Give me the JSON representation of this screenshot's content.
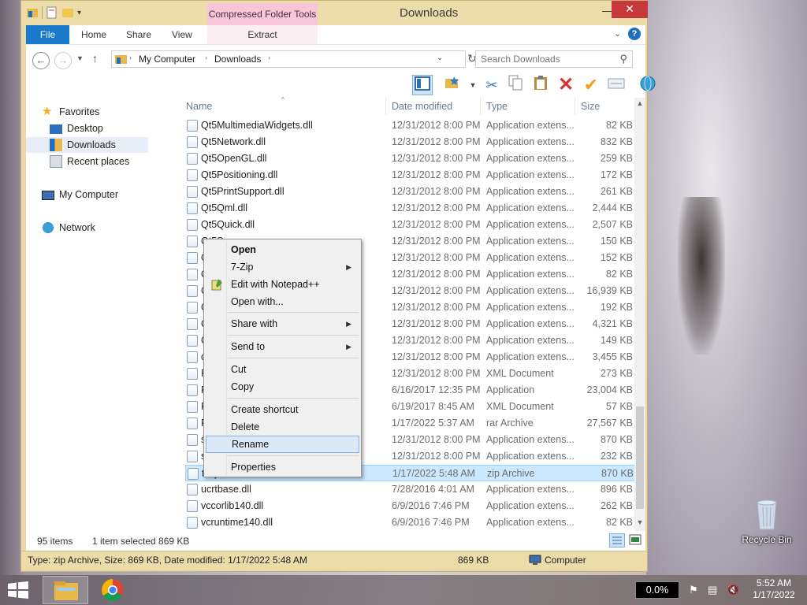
{
  "window": {
    "title": "Downloads",
    "context_tools_label": "Compressed Folder Tools",
    "minimize": "—",
    "maximize": "☐",
    "close": "✕"
  },
  "ribbon": {
    "tabs": [
      "File",
      "Home",
      "Share",
      "View",
      "Extract"
    ],
    "help": "?"
  },
  "address": {
    "breadcrumb": [
      "My Computer",
      "Downloads"
    ],
    "search_placeholder": "Search Downloads"
  },
  "nav": {
    "favorites": "Favorites",
    "desktop": "Desktop",
    "downloads": "Downloads",
    "recent": "Recent places",
    "computer": "My Computer",
    "network": "Network"
  },
  "columns": [
    "Name",
    "Date modified",
    "Type",
    "Size"
  ],
  "files": [
    {
      "name": "Qt5MultimediaWidgets.dll",
      "date": "12/31/2012 8:00 PM",
      "type": "Application extens...",
      "size": "82 KB"
    },
    {
      "name": "Qt5Network.dll",
      "date": "12/31/2012 8:00 PM",
      "type": "Application extens...",
      "size": "832 KB"
    },
    {
      "name": "Qt5OpenGL.dll",
      "date": "12/31/2012 8:00 PM",
      "type": "Application extens...",
      "size": "259 KB"
    },
    {
      "name": "Qt5Positioning.dll",
      "date": "12/31/2012 8:00 PM",
      "type": "Application extens...",
      "size": "172 KB"
    },
    {
      "name": "Qt5PrintSupport.dll",
      "date": "12/31/2012 8:00 PM",
      "type": "Application extens...",
      "size": "261 KB"
    },
    {
      "name": "Qt5Qml.dll",
      "date": "12/31/2012 8:00 PM",
      "type": "Application extens...",
      "size": "2,444 KB"
    },
    {
      "name": "Qt5Quick.dll",
      "date": "12/31/2012 8:00 PM",
      "type": "Application extens...",
      "size": "2,507 KB"
    },
    {
      "name": "Qt5Se",
      "date": "12/31/2012 8:00 PM",
      "type": "Application extens...",
      "size": "150 KB"
    },
    {
      "name": "Qt5Sc",
      "date": "12/31/2012 8:00 PM",
      "type": "Application extens...",
      "size": "152 KB"
    },
    {
      "name": "Qt5W",
      "date": "12/31/2012 8:00 PM",
      "type": "Application extens...",
      "size": "82 KB"
    },
    {
      "name": "Qt5W",
      "date": "12/31/2012 8:00 PM",
      "type": "Application extens...",
      "size": "16,939 KB"
    },
    {
      "name": "Qt5W",
      "date": "12/31/2012 8:00 PM",
      "type": "Application extens...",
      "size": "192 KB"
    },
    {
      "name": "Qt5W",
      "date": "12/31/2012 8:00 PM",
      "type": "Application extens...",
      "size": "4,321 KB"
    },
    {
      "name": "Qt5Xi",
      "date": "12/31/2012 8:00 PM",
      "type": "Application extens...",
      "size": "149 KB"
    },
    {
      "name": "qtnril",
      "date": "12/31/2012 8:00 PM",
      "type": "Application extens...",
      "size": "3,455 KB"
    },
    {
      "name": "Reflec",
      "date": "12/31/2012 8:00 PM",
      "type": "XML Document",
      "size": "273 KB"
    },
    {
      "name": "Roblo",
      "date": "6/16/2017 12:35 PM",
      "type": "Application",
      "size": "23,004 KB"
    },
    {
      "name": "Roblo",
      "date": "6/19/2017 8:45 AM",
      "type": "XML Document",
      "size": "57 KB"
    },
    {
      "name": "RoCR",
      "date": "1/17/2022 5:37 AM",
      "type": "rar Archive",
      "size": "27,567 KB"
    },
    {
      "name": "sgCo",
      "date": "12/31/2012 8:00 PM",
      "type": "Application extens...",
      "size": "870 KB"
    },
    {
      "name": "ssleay",
      "date": "12/31/2012 8:00 PM",
      "type": "Application extens...",
      "size": "232 KB"
    },
    {
      "name": "tvnjvi",
      "date": "1/17/2022 5:48 AM",
      "type": "zip Archive",
      "size": "870 KB"
    },
    {
      "name": "ucrtbase.dll",
      "date": "7/28/2016 4:01 AM",
      "type": "Application extens...",
      "size": "896 KB"
    },
    {
      "name": "vccorlib140.dll",
      "date": "6/9/2016 7:46 PM",
      "type": "Application extens...",
      "size": "262 KB"
    },
    {
      "name": "vcruntime140.dll",
      "date": "6/9/2016 7:46 PM",
      "type": "Application extens...",
      "size": "82 KB"
    }
  ],
  "status": {
    "items": "95 items",
    "selected": "1 item selected  869 KB",
    "details": "Type: zip Archive, Size: 869 KB, Date modified: 1/17/2022 5:48 AM",
    "size": "869 KB",
    "location": "Computer"
  },
  "context_menu": {
    "open": "Open",
    "zip": "7-Zip",
    "notepad": "Edit with Notepad++",
    "open_with": "Open with...",
    "share_with": "Share with",
    "send_to": "Send to",
    "cut": "Cut",
    "copy": "Copy",
    "shortcut": "Create shortcut",
    "delete": "Delete",
    "rename": "Rename",
    "properties": "Properties"
  },
  "desktop": {
    "recycle_bin": "Recycle Bin"
  },
  "taskbar": {
    "percent": "0.0%",
    "time": "5:52 AM",
    "date": "1/17/2022"
  },
  "colors": {
    "accent": "#1979ca",
    "selection": "#cce8ff",
    "title_bar": "#ebdcaa",
    "context_tab": "#f7c7d9",
    "close": "#c7383a"
  }
}
